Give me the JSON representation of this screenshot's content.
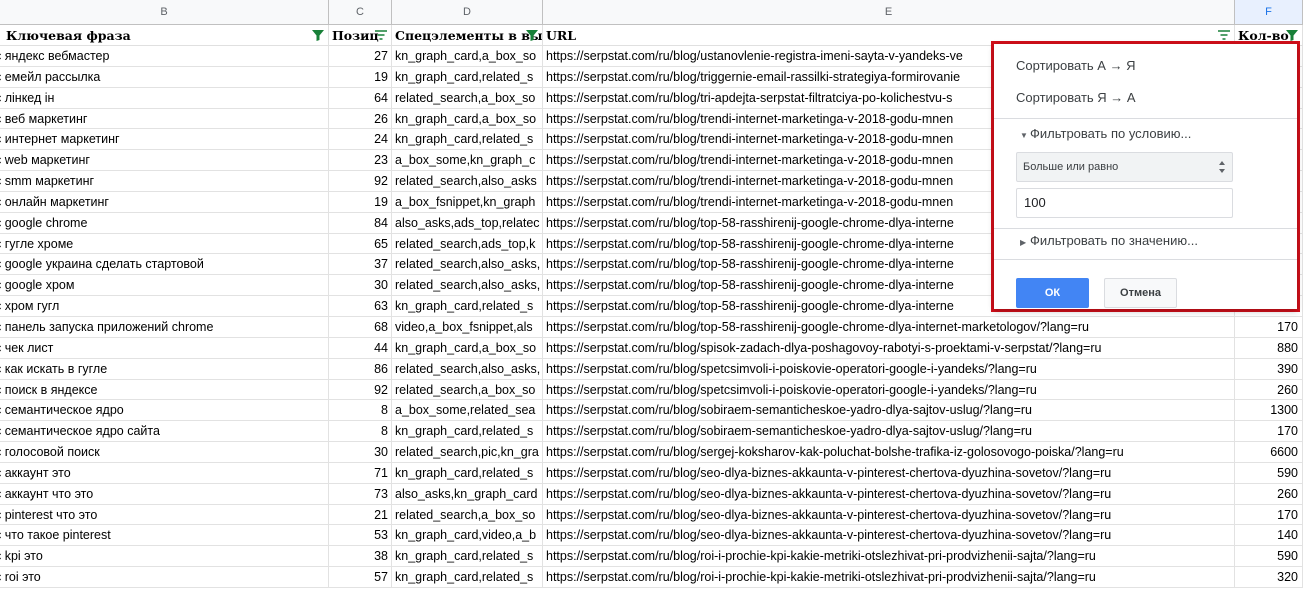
{
  "columns": {
    "b": "B",
    "c": "C",
    "d": "D",
    "e": "E",
    "f": "F"
  },
  "headers": {
    "keyword": "Ключевая фраза",
    "position": "Позиц",
    "features": "Спецэлементы в вы",
    "url": "URL",
    "volume": "Кол-во"
  },
  "rows": [
    {
      "k": "яндекс вебмастер",
      "p": "27",
      "d": "kn_graph_card,a_box_so",
      "u": "https://serpstat.com/ru/blog/ustanovlenie-registra-imeni-sayta-v-yandeks-ve",
      "v": ""
    },
    {
      "k": "емейл рассылка",
      "p": "19",
      "d": "kn_graph_card,related_s",
      "u": "https://serpstat.com/ru/blog/triggernie-email-rassilki-strategiya-formirovanie",
      "v": ""
    },
    {
      "k": "лінкед ін",
      "p": "64",
      "d": "related_search,a_box_so",
      "u": "https://serpstat.com/ru/blog/tri-apdejta-serpstat-filtratciya-po-kolichestvu-s",
      "v": ""
    },
    {
      "k": "веб маркетинг",
      "p": "26",
      "d": "kn_graph_card,a_box_so",
      "u": "https://serpstat.com/ru/blog/trendi-internet-marketinga-v-2018-godu-mnen",
      "v": ""
    },
    {
      "k": "интернет маркетинг",
      "p": "24",
      "d": "kn_graph_card,related_s",
      "u": "https://serpstat.com/ru/blog/trendi-internet-marketinga-v-2018-godu-mnen",
      "v": ""
    },
    {
      "k": "web маркетинг",
      "p": "23",
      "d": "a_box_some,kn_graph_c",
      "u": "https://serpstat.com/ru/blog/trendi-internet-marketinga-v-2018-godu-mnen",
      "v": ""
    },
    {
      "k": "smm маркетинг",
      "p": "92",
      "d": "related_search,also_asks",
      "u": "https://serpstat.com/ru/blog/trendi-internet-marketinga-v-2018-godu-mnen",
      "v": ""
    },
    {
      "k": "онлайн маркетинг",
      "p": "19",
      "d": "a_box_fsnippet,kn_graph",
      "u": "https://serpstat.com/ru/blog/trendi-internet-marketinga-v-2018-godu-mnen",
      "v": ""
    },
    {
      "k": "google chrome",
      "p": "84",
      "d": "also_asks,ads_top,relatec",
      "u": "https://serpstat.com/ru/blog/top-58-rasshirenij-google-chrome-dlya-interne",
      "v": ""
    },
    {
      "k": "гугле хроме",
      "p": "65",
      "d": "related_search,ads_top,k",
      "u": "https://serpstat.com/ru/blog/top-58-rasshirenij-google-chrome-dlya-interne",
      "v": ""
    },
    {
      "k": "google украина сделать стартовой",
      "p": "37",
      "d": "related_search,also_asks,",
      "u": "https://serpstat.com/ru/blog/top-58-rasshirenij-google-chrome-dlya-interne",
      "v": ""
    },
    {
      "k": "google хром",
      "p": "30",
      "d": "related_search,also_asks,",
      "u": "https://serpstat.com/ru/blog/top-58-rasshirenij-google-chrome-dlya-interne",
      "v": ""
    },
    {
      "k": "хром гугл",
      "p": "63",
      "d": "kn_graph_card,related_s",
      "u": "https://serpstat.com/ru/blog/top-58-rasshirenij-google-chrome-dlya-interne",
      "v": ""
    },
    {
      "k": "панель запуска приложений chrome",
      "p": "68",
      "d": "video,a_box_fsnippet,als",
      "u": "https://serpstat.com/ru/blog/top-58-rasshirenij-google-chrome-dlya-internet-marketologov/?lang=ru",
      "v": "170"
    },
    {
      "k": "чек лист",
      "p": "44",
      "d": "kn_graph_card,a_box_so",
      "u": "https://serpstat.com/ru/blog/spisok-zadach-dlya-poshagovoy-rabotyi-s-proektami-v-serpstat/?lang=ru",
      "v": "880"
    },
    {
      "k": "как искать в гугле",
      "p": "86",
      "d": "related_search,also_asks,",
      "u": "https://serpstat.com/ru/blog/spetcsimvoli-i-poiskovie-operatori-google-i-yandeks/?lang=ru",
      "v": "390"
    },
    {
      "k": "поиск в яндексе",
      "p": "92",
      "d": "related_search,a_box_so",
      "u": "https://serpstat.com/ru/blog/spetcsimvoli-i-poiskovie-operatori-google-i-yandeks/?lang=ru",
      "v": "260"
    },
    {
      "k": "семантическое ядро",
      "p": "8",
      "d": "a_box_some,related_sea",
      "u": "https://serpstat.com/ru/blog/sobiraem-semanticheskoe-yadro-dlya-sajtov-uslug/?lang=ru",
      "v": "1300"
    },
    {
      "k": "семантическое ядро сайта",
      "p": "8",
      "d": "kn_graph_card,related_s",
      "u": "https://serpstat.com/ru/blog/sobiraem-semanticheskoe-yadro-dlya-sajtov-uslug/?lang=ru",
      "v": "170"
    },
    {
      "k": "голосовой поиск",
      "p": "30",
      "d": "related_search,pic,kn_gra",
      "u": "https://serpstat.com/ru/blog/sergej-koksharov-kak-poluchat-bolshe-trafika-iz-golosovogo-poiska/?lang=ru",
      "v": "6600"
    },
    {
      "k": "аккаунт это",
      "p": "71",
      "d": "kn_graph_card,related_s",
      "u": "https://serpstat.com/ru/blog/seo-dlya-biznes-akkaunta-v-pinterest-chertova-dyuzhina-sovetov/?lang=ru",
      "v": "590"
    },
    {
      "k": "аккаунт что это",
      "p": "73",
      "d": "also_asks,kn_graph_card",
      "u": "https://serpstat.com/ru/blog/seo-dlya-biznes-akkaunta-v-pinterest-chertova-dyuzhina-sovetov/?lang=ru",
      "v": "260"
    },
    {
      "k": "pinterest что это",
      "p": "21",
      "d": "related_search,a_box_so",
      "u": "https://serpstat.com/ru/blog/seo-dlya-biznes-akkaunta-v-pinterest-chertova-dyuzhina-sovetov/?lang=ru",
      "v": "170"
    },
    {
      "k": "что такое pinterest",
      "p": "53",
      "d": "kn_graph_card,video,a_b",
      "u": "https://serpstat.com/ru/blog/seo-dlya-biznes-akkaunta-v-pinterest-chertova-dyuzhina-sovetov/?lang=ru",
      "v": "140"
    },
    {
      "k": "kpi это",
      "p": "38",
      "d": "kn_graph_card,related_s",
      "u": "https://serpstat.com/ru/blog/roi-i-prochie-kpi-kakie-metriki-otslezhivat-pri-prodvizhenii-sajta/?lang=ru",
      "v": "590"
    },
    {
      "k": "roi это",
      "p": "57",
      "d": "kn_graph_card,related_s",
      "u": "https://serpstat.com/ru/blog/roi-i-prochie-kpi-kakie-metriki-otslezhivat-pri-prodvizhenii-sajta/?lang=ru",
      "v": "320"
    }
  ],
  "popup": {
    "sort_asc": "Сортировать А → Я",
    "sort_desc": "Сортировать Я → А",
    "filter_condition": "Фильтровать по условию...",
    "condition_value": "Больше или равно",
    "input_value": "100",
    "filter_value": "Фильтровать по значению...",
    "ok": "ОК",
    "cancel": "Отмена"
  },
  "colors": {
    "accent": "#1a73e8",
    "filter_green": "#188038",
    "highlight_border": "#d20f1a",
    "ok_button": "#4285f4"
  }
}
